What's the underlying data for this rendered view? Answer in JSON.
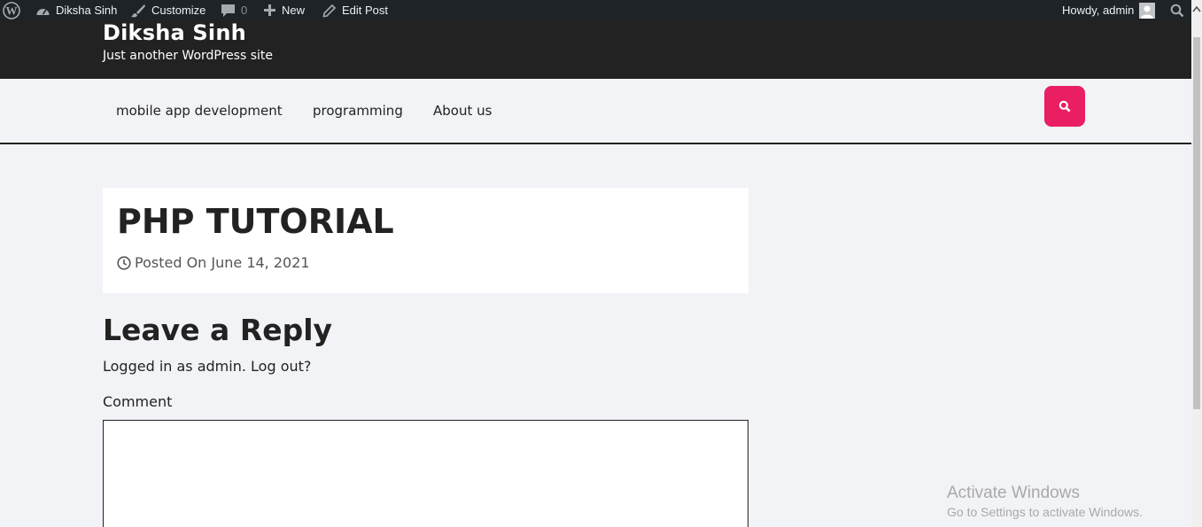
{
  "admin_bar": {
    "wp_logo_icon": "wordpress-icon",
    "site_name": "Diksha Sinh",
    "customize": "Customize",
    "comments_count": "0",
    "new": "New",
    "edit_post": "Edit Post",
    "howdy": "Howdy, admin"
  },
  "header": {
    "site_title": "Diksha Sinh",
    "tagline": "Just another WordPress site"
  },
  "nav": {
    "items": [
      {
        "label": "mobile app development"
      },
      {
        "label": "programming"
      },
      {
        "label": "About us"
      }
    ],
    "search_button_color": "#e91e63"
  },
  "post": {
    "title": "PHP TUTORIAL",
    "meta": "Posted On June 14, 2021"
  },
  "reply": {
    "title": "Leave a Reply",
    "logged_in": "Logged in as admin. Log out?",
    "comment_label": "Comment"
  },
  "watermark": {
    "title": "Activate Windows",
    "subtitle": "Go to Settings to activate Windows."
  }
}
